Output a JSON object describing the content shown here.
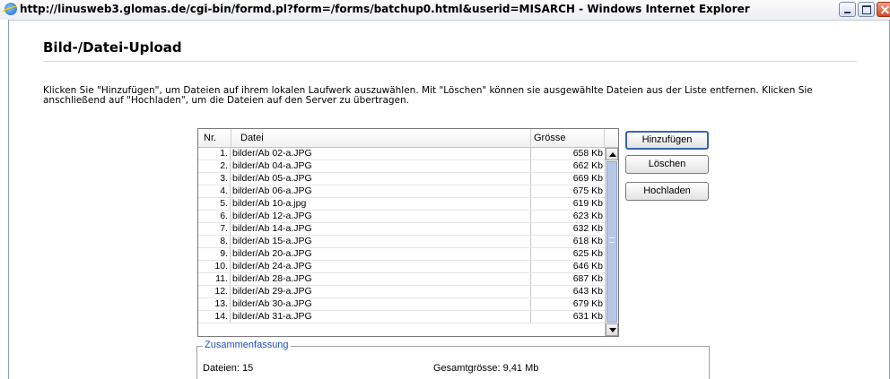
{
  "window": {
    "title": "http://linusweb3.glomas.de/cgi-bin/formd.pl?form=/forms/batchup0.html&userid=MISARCH - Windows Internet Explorer"
  },
  "page": {
    "heading": "Bild-/Datei-Upload",
    "instructions": "Klicken Sie \"Hinzufügen\", um Dateien auf ihrem lokalen Laufwerk auszuwählen. Mit \"Löschen\" können sie ausgewählte Dateien aus der Liste entfernen. Klicken Sie anschließend auf \"Hochladen\", um die Dateien auf den Server zu übertragen."
  },
  "table": {
    "columns": [
      "Nr.",
      "Datei",
      "Grösse"
    ],
    "rows": [
      {
        "nr": "1.",
        "file": "bilder/Ab 02-a.JPG",
        "size": "658 Kb"
      },
      {
        "nr": "2.",
        "file": "bilder/Ab 04-a.JPG",
        "size": "662 Kb"
      },
      {
        "nr": "3.",
        "file": "bilder/Ab 05-a.JPG",
        "size": "669 Kb"
      },
      {
        "nr": "4.",
        "file": "bilder/Ab 06-a.JPG",
        "size": "675 Kb"
      },
      {
        "nr": "5.",
        "file": "bilder/Ab 10-a.jpg",
        "size": "619 Kb"
      },
      {
        "nr": "6.",
        "file": "bilder/Ab 12-a.JPG",
        "size": "623 Kb"
      },
      {
        "nr": "7.",
        "file": "bilder/Ab 14-a.JPG",
        "size": "632 Kb"
      },
      {
        "nr": "8.",
        "file": "bilder/Ab 15-a.JPG",
        "size": "618 Kb"
      },
      {
        "nr": "9.",
        "file": "bilder/Ab 20-a.JPG",
        "size": "625 Kb"
      },
      {
        "nr": "10.",
        "file": "bilder/Ab 24-a.JPG",
        "size": "646 Kb"
      },
      {
        "nr": "11.",
        "file": "bilder/Ab 28-a.JPG",
        "size": "687 Kb"
      },
      {
        "nr": "12.",
        "file": "bilder/Ab 29-a.JPG",
        "size": "643 Kb"
      },
      {
        "nr": "13.",
        "file": "bilder/Ab 30-a.JPG",
        "size": "679 Kb"
      },
      {
        "nr": "14.",
        "file": "bilder/Ab 31-a.JPG",
        "size": "631 Kb"
      }
    ]
  },
  "buttons": {
    "add": "Hinzufügen",
    "delete": "Löschen",
    "upload": "Hochladen"
  },
  "summary": {
    "legend": "Zusammenfassung",
    "files": "Dateien: 15",
    "total": "Gesamtgrösse: 9,41 Mb"
  },
  "icons": [
    "ie-icon",
    "minimize-icon",
    "maximize-icon",
    "close-icon",
    "scroll-up-arrow-icon",
    "scroll-down-arrow-icon"
  ],
  "colors": {
    "legend_text": "#2050c0",
    "scroll_thumb": "#b8c8e4",
    "close_button": "#d2472a"
  }
}
